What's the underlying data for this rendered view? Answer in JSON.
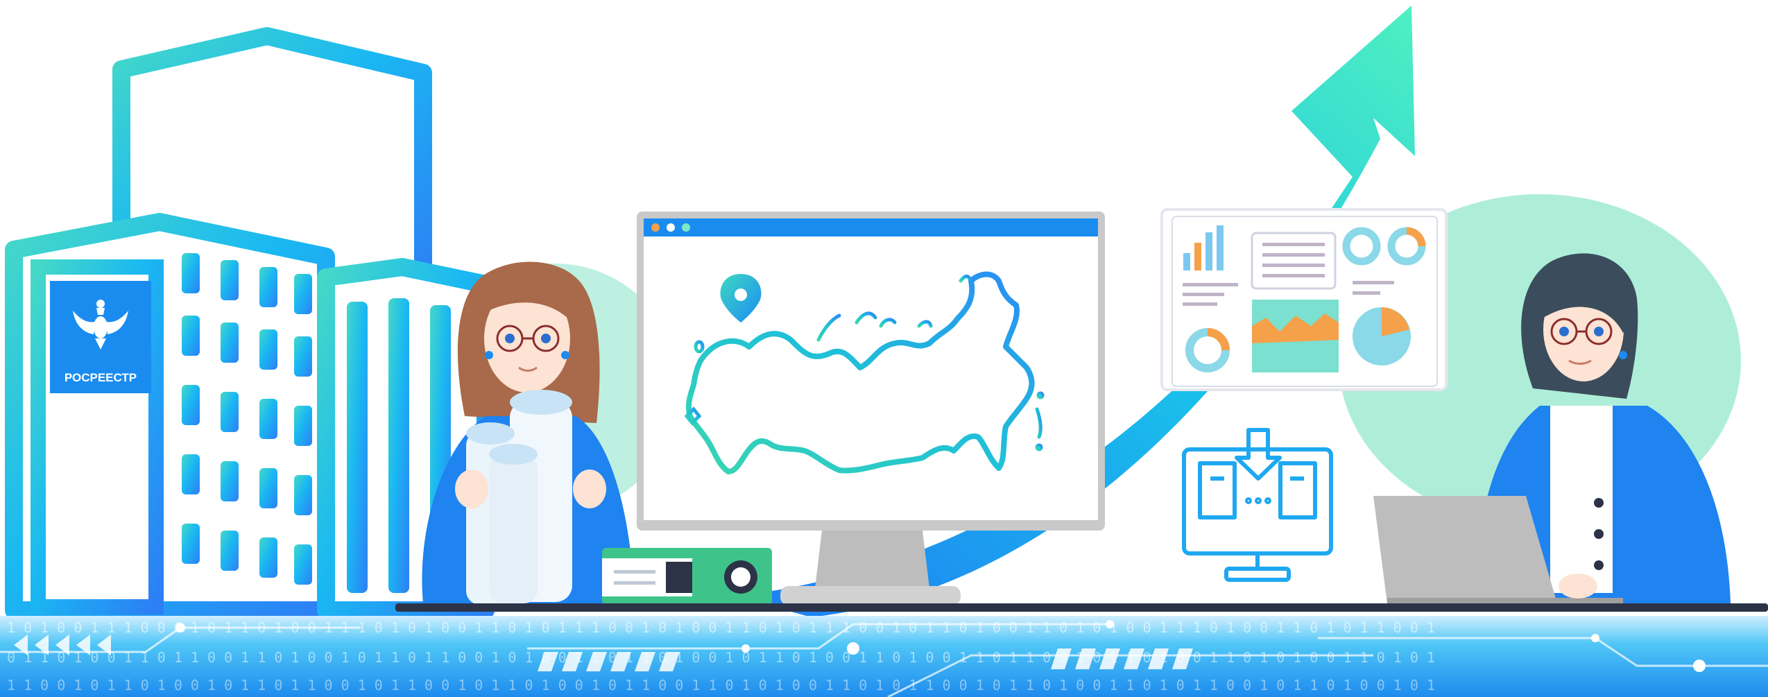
{
  "logo": {
    "name": "РОСРЕЕСТР",
    "icon": "double-headed-eagle-emblem"
  },
  "footer": {
    "binary_rows": [
      "1 0 1 0 0 1 1 1 0 0 0 1 0 1 1 0 1 0 0 1 1 1 0 1 0 1 0 0 1 1 0 1 0 1 1 1 0 0 1 0 1 0 0 1 1 0 1 0 1 1 1 0 0 1 0 1 1 0 1 0 0 1 1 0 1 0 1 0 0 1 1 1 0 1 0 0 1 1 0 1 0 1 1 0 0 1",
      "0 1 1 0 1 0 0 1 1 0 1 1 0 0 1 1 0 1 0 0 1 0 1 1 0 1 1 0 0 1 0 1 0 0 1 1 0 1 1 0 1 0 0 1 0 1 1 0 1 0 0 1 1 0 1 0 0 1 1 0 1 1 0 0 1 0 1 1 0 1 0 0 1 1 0 1 0 1 0 0 1 1 0 1 0 1",
      "1 1 0 0 1 0 1 1 0 1 0 0 1 0 1 1 0 1 1 0 0 1 0 1 1 0 0 1 0 1 1 0 1 0 0 1 0 1 1 0 0 1 1 0 1 0 1 0 0 1 1 0 1 0 1 1 0 0 1 0 1 1 0 1 0 0 1 1 0 1 0 1 1 0 0 1 0 1 1 0 1 0 0 1 0 1"
    ]
  },
  "colors": {
    "brand_blue": "#1a8cf0",
    "teal": "#3fd6c4",
    "mint": "#a8ecd9",
    "cyan": "#19b6f0",
    "orange": "#f5a14a",
    "dark": "#2c3347"
  }
}
